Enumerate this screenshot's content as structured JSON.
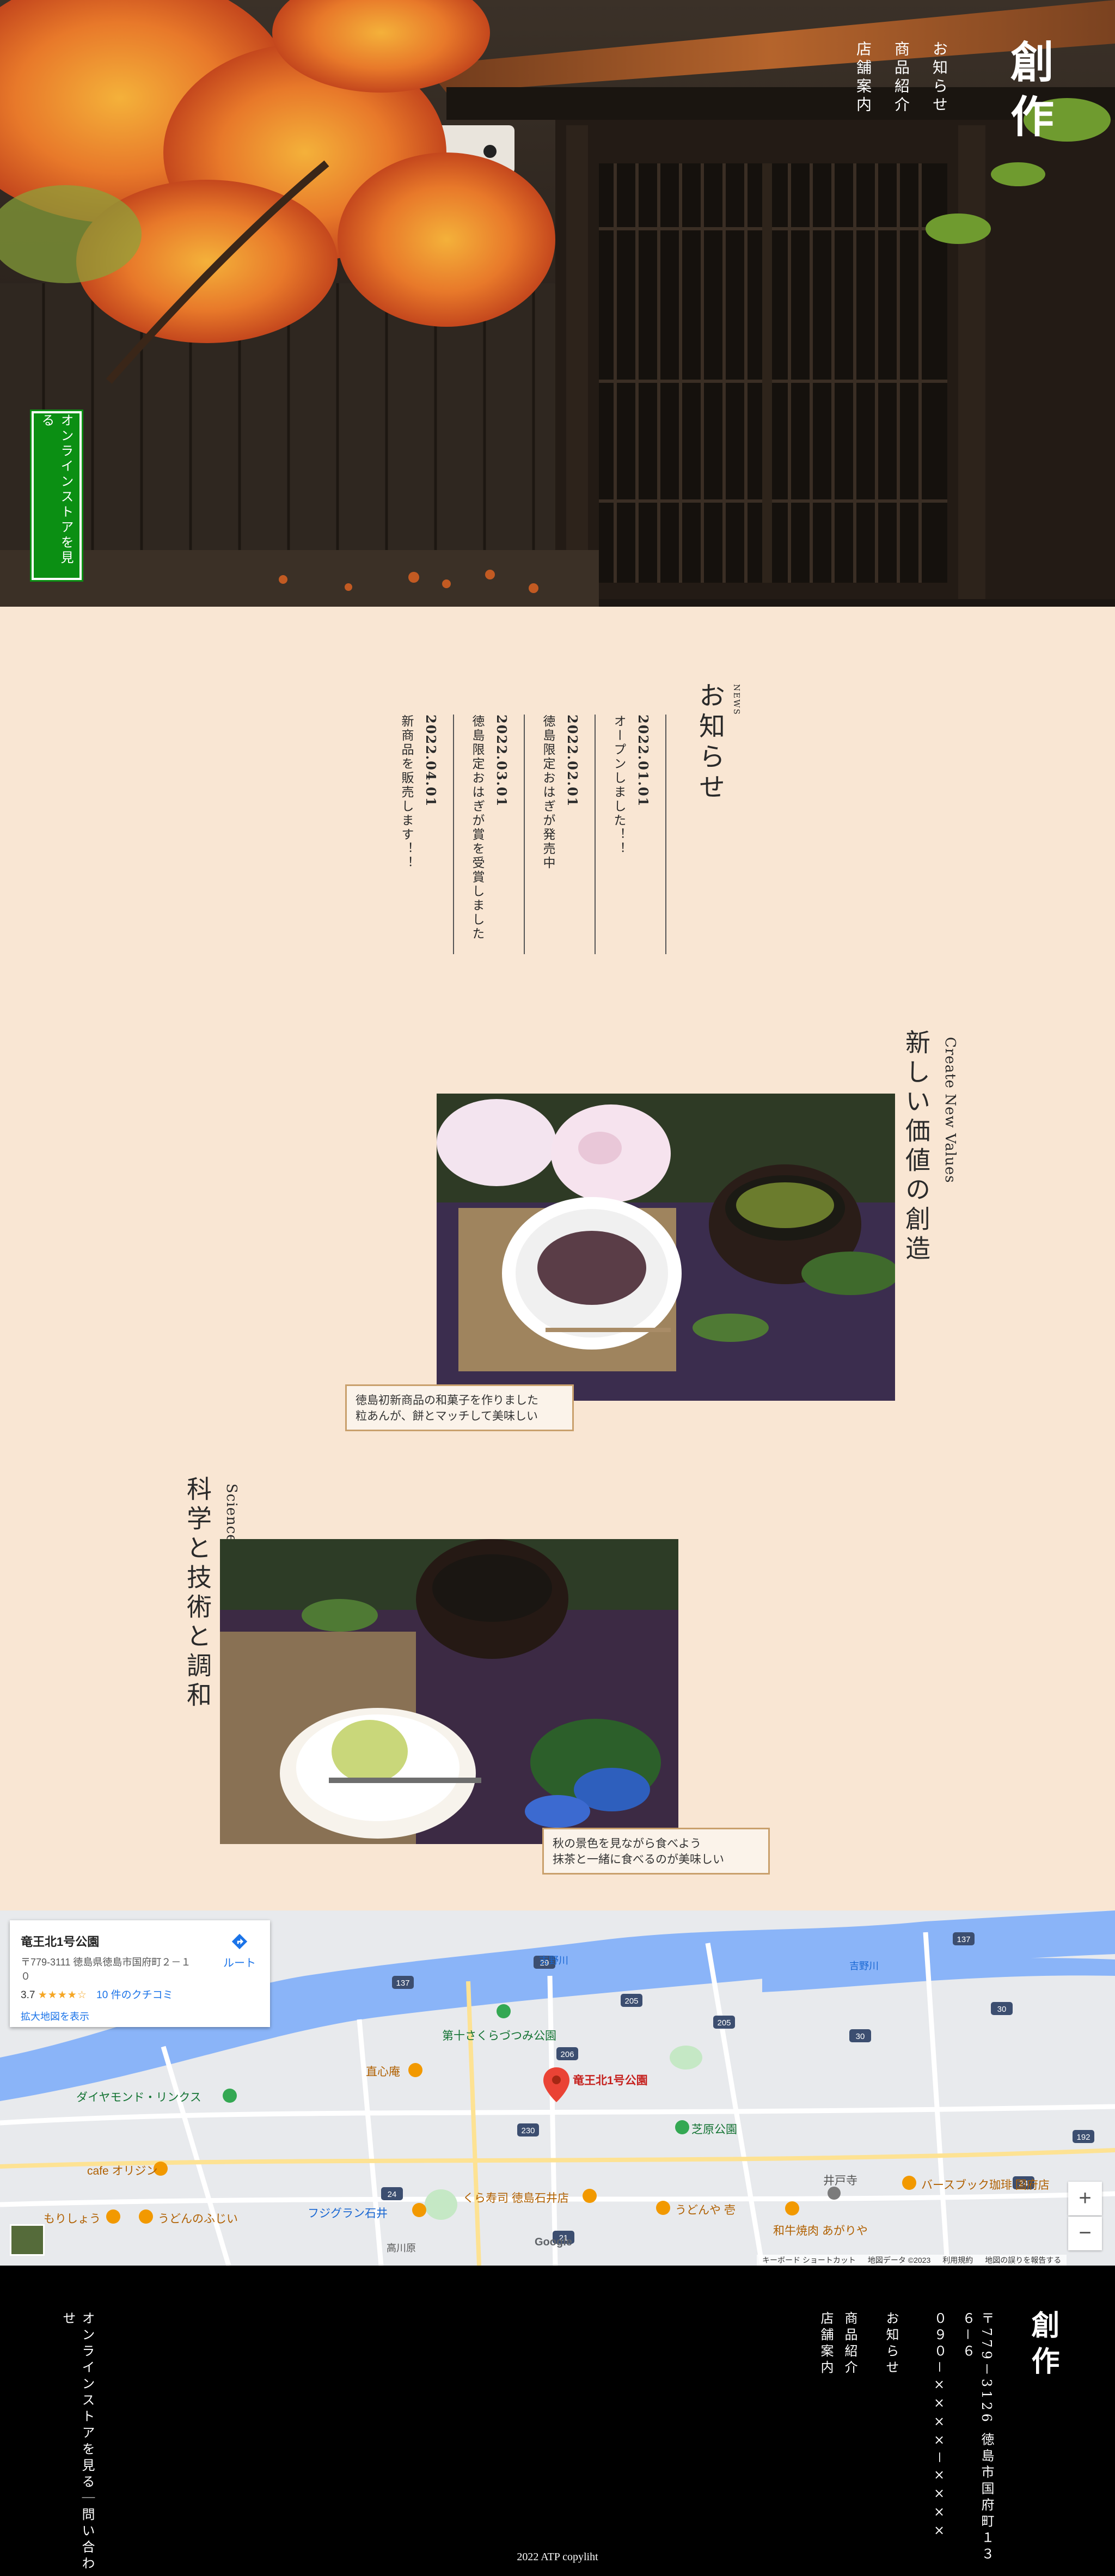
{
  "header": {
    "logo": "創作",
    "nav": [
      "お知らせ",
      "商品紹介",
      "店舗案内"
    ],
    "online_store_button": "オンラインストアを見る"
  },
  "news": {
    "heading": "お知らせ",
    "heading_en": "NEWS",
    "items": [
      {
        "date": "2022.01.01",
        "text": "オープンしました！！"
      },
      {
        "date": "2022.02.01",
        "text": "徳島限定おはぎが発売中"
      },
      {
        "date": "2022.03.01",
        "text": "徳島限定おはぎが賞を受賞しました"
      },
      {
        "date": "2022.04.01",
        "text": "新商品を販売します！！"
      }
    ]
  },
  "features": [
    {
      "title": "新しい価値の創造",
      "subtitle": "Create New Values",
      "caption_line1": "徳島初新商品の和菓子を作りました",
      "caption_line2": "粒あんが、餅とマッチして美味しい"
    },
    {
      "title": "科学と技術と調和",
      "subtitle": "Science & Technology",
      "caption_line1": "秋の景色を見ながら食べよう",
      "caption_line2": "抹茶と一緒に食べるのが美味しい"
    }
  ],
  "map": {
    "place_name": "竜王北1号公園",
    "address": "〒779-3111 徳島県徳島市国府町２－１０",
    "rating": "3.7",
    "stars": "★★★★☆",
    "reviews": "10 件のクチコミ",
    "enlarge": "拡大地図を表示",
    "route": "ルート",
    "pin_label": "竜王北1号公園",
    "labels": {
      "park": "第十さくらづつみ公園",
      "shop1": "直心庵",
      "golf": "ダイヤモンド・リンクス",
      "park2": "芝原公園",
      "cafe": "cafe オリジン",
      "morishou": "もりしょう",
      "udon": "うどんのふじい",
      "fujigran": "フジグラン石井",
      "kura": "くら寿司 徳島石井店",
      "udon2": "うどんや 壱",
      "ide": "井戸寺",
      "barsbook": "バースブック珈琲 国府店",
      "wagyu": "和牛焼肉 あがりや",
      "river1": "吉野川",
      "river2": "吉野川",
      "takagawara": "高川原"
    },
    "route_numbers": [
      "137",
      "29",
      "137",
      "30",
      "205",
      "206",
      "30",
      "230",
      "24",
      "24",
      "192",
      "21",
      "205"
    ],
    "footer_items": [
      "キーボード ショートカット",
      "地図データ ©2023",
      "利用規約",
      "地図の誤りを報告する"
    ],
    "google_logo": "Google",
    "zoom_in": "+",
    "zoom_out": "−"
  },
  "footer": {
    "logo": "創作",
    "address": "〒779－3126 徳島市国府町１３６－６",
    "phone": "０９０－××××－××××",
    "nav": [
      "お知らせ",
      "商品紹介",
      "店舗案内"
    ],
    "links": [
      "オンラインストアを見る",
      "問い合わせ"
    ],
    "copyright": "2022 ATP copyliht"
  },
  "colors": {
    "page_bg": "#f9e6d3",
    "button_green": "#0b8f13",
    "caption_border": "#c9a06c",
    "footer_bg": "#000000"
  }
}
